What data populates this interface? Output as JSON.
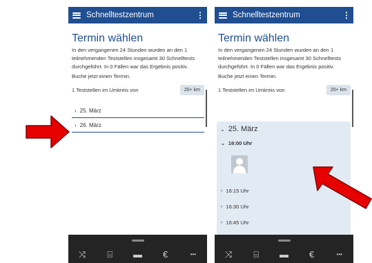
{
  "app": {
    "title": "Schnelltestzentrum"
  },
  "icons": {
    "menu": "hamburger-icon",
    "more": "kebab-icon",
    "shuffle": "shuffle-icon",
    "chat": "chat-icon",
    "card": "card-icon",
    "euro": "euro-icon",
    "dots": "more-dots-icon"
  },
  "colors": {
    "primary": "#1f4e91",
    "arrow": "#e60000",
    "nav_bg": "#242424",
    "card_bg": "#e2eaf3"
  },
  "page": {
    "title": "Termin wählen",
    "intro": "In den vergangenen 24 Stunden wurden an den 1 teilnehmenden Teststellen insgesamt 30 Schnelltests durchgeführt. In 0 Fällen war das Ergebnis positiv.",
    "book": "Buche jetzt einen Termin.",
    "radius_label": "1 Teststellen im Umkreis von",
    "radius_value": "20+ km"
  },
  "dates": [
    {
      "label": "25. März"
    },
    {
      "label": "26. März"
    }
  ],
  "expanded": {
    "date": "25. März",
    "open_slot": "16:00 Uhr",
    "slots": [
      "16:15 Uhr",
      "16:30 Uhr",
      "16:45 Uhr"
    ]
  },
  "nav": {
    "shuffle": "⤨",
    "chat": "⌸",
    "card": "▬",
    "euro": "€",
    "dots": "•••"
  },
  "glyphs": {
    "chevron_right": "›",
    "chevron_down": "⌄",
    "kebab": "⋮"
  }
}
